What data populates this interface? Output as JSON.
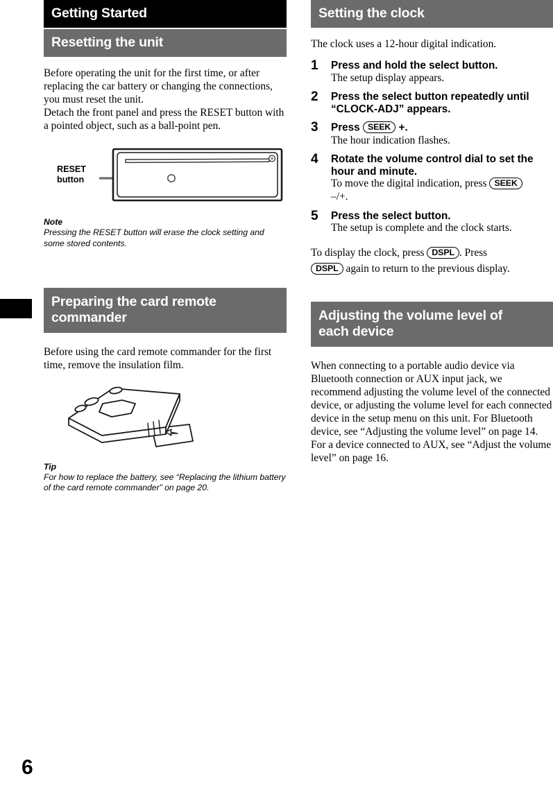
{
  "page": {
    "number": "6",
    "accent_gray": "#6b6b6b",
    "accent_black": "#000000"
  },
  "left_column": {
    "chapter_heading": "Getting Started",
    "section_heading": "Resetting the unit",
    "intro_paragraph": "Before operating the unit for the first time, or after replacing the car battery or changing the connections, you must reset the unit.\nDetach the front panel and press the RESET button with a pointed object, such as a ball-point pen.",
    "figure_reset": {
      "label_line1": "RESET",
      "label_line2": "button",
      "caption": "front panel chassis with RESET button"
    },
    "note": {
      "heading": "Note",
      "text": "Pressing the RESET button will erase the clock setting and some stored contents."
    },
    "section_heading_2_line1": "Preparing the card remote",
    "section_heading_2_line2": "commander",
    "paragraph_2": "Before using the card remote commander for the first time, remove the insulation film.",
    "figure_remote": {
      "caption": "card remote commander with insulation film being pulled out"
    },
    "tip": {
      "heading": "Tip",
      "text": "For how to replace the battery, see “Replacing the lithium battery of the card remote commander” on page 20."
    }
  },
  "right_column": {
    "section_heading": "Setting the clock",
    "intro_paragraph": "The clock uses a 12-hour digital indication.",
    "steps": [
      {
        "number": "1",
        "title": "Press and hold the select button.",
        "desc": "The setup display appears."
      },
      {
        "number": "2",
        "title": "Press the select button repeatedly until “CLOCK-ADJ” appears.",
        "desc": ""
      },
      {
        "number": "3",
        "title_pre": "Press ",
        "title_button": "SEEK",
        "title_post": " +.",
        "number_label": "3",
        "desc": "The hour indication flashes."
      },
      {
        "number": "4",
        "title": "Rotate the volume control dial to set the hour and minute.",
        "desc_pre": "To move the digital indication, press ",
        "desc_button": "SEEK",
        "desc_post": "–/+."
      },
      {
        "number": "5",
        "title": "Press the select button.",
        "desc": "The setup is complete and the clock starts."
      }
    ],
    "display_paragraph": {
      "pre": "To display the clock, press ",
      "button1": "DSPL",
      "mid": ". Press",
      "button2": "DSPL",
      "post": " again to return to the previous display."
    },
    "section_heading_2_line1": "Adjusting the volume level of",
    "section_heading_2_line2": "each device",
    "paragraph_2": "When connecting to a portable audio device via Bluetooth connection or AUX input jack, we recommend adjusting the volume level of the connected device, or adjusting the volume level for each connected device in the setup menu on this unit. For Bluetooth device, see “Adjusting the volume level” on page 14. For a device connected to AUX, see “Adjust the volume level” on page 16."
  }
}
